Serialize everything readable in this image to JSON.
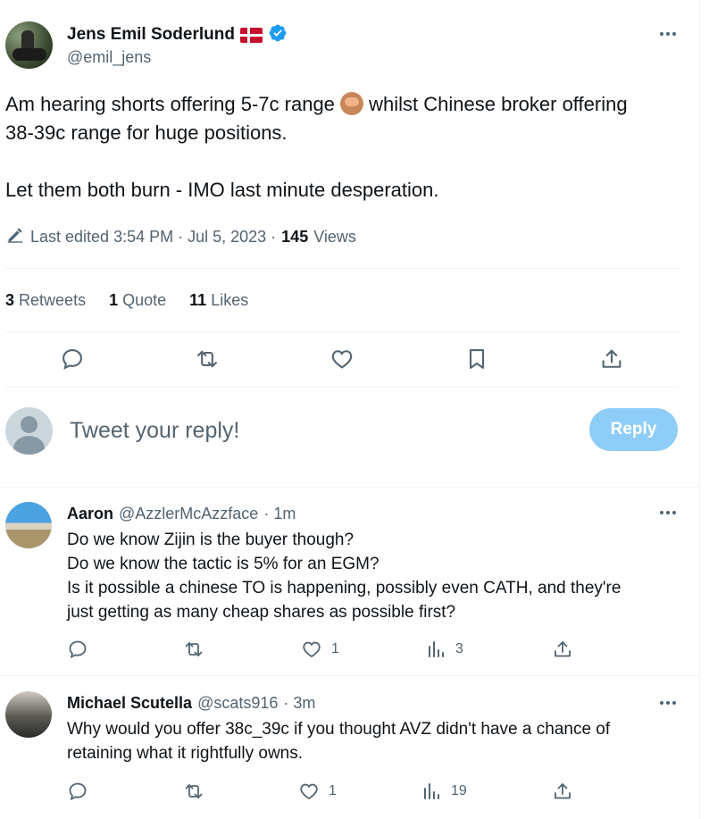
{
  "tweet": {
    "author_name": "Jens Emil Soderlund",
    "handle": "@emil_jens",
    "line1_a": "Am hearing shorts offering 5-7c range ",
    "line1_b": " whilst Chinese broker offering",
    "line2": "38-39c range for huge positions.",
    "line3": "Let them both burn - IMO last minute desperation.",
    "edited_label": "Last edited 3:54 PM · Jul 5, 2023 ·",
    "views_count": "145",
    "views_label": "Views",
    "retweets_count": "3",
    "retweets_label": "Retweets",
    "quotes_count": "1",
    "quotes_label": "Quote",
    "likes_count": "11",
    "likes_label": "Likes"
  },
  "compose": {
    "placeholder": "Tweet your reply!",
    "button_label": "Reply"
  },
  "replies": [
    {
      "name": "Aaron",
      "handle": "@AzzlerMcAzzface",
      "time": "· 1m",
      "lines": [
        "Do we know Zijin is the buyer though?",
        "Do we know the tactic is 5% for an EGM?",
        "Is it possible a chinese TO is happening, possibly even CATH, and they're",
        "just getting as many cheap shares as possible first?"
      ],
      "likes": "1",
      "views": "3"
    },
    {
      "name": "Michael Scutella",
      "handle": "@scats916",
      "time": "· 3m",
      "lines": [
        "Why would you offer 38c_39c if you thought AVZ didn't have a chance of",
        "retaining what it rightfully owns."
      ],
      "likes": "1",
      "views": "19"
    }
  ],
  "colors": {
    "accent": "#1d9bf0",
    "reply_button_disabled": "#8ecdf8",
    "muted_text": "#536471",
    "divider": "#eff3f4"
  },
  "icons": [
    "more-icon",
    "verified-badge-icon",
    "denmark-flag-icon",
    "monkey-emoji-icon",
    "pencil-icon",
    "reply-icon",
    "retweet-icon",
    "like-icon",
    "bookmark-icon",
    "share-icon",
    "views-icon",
    "default-avatar-icon"
  ]
}
